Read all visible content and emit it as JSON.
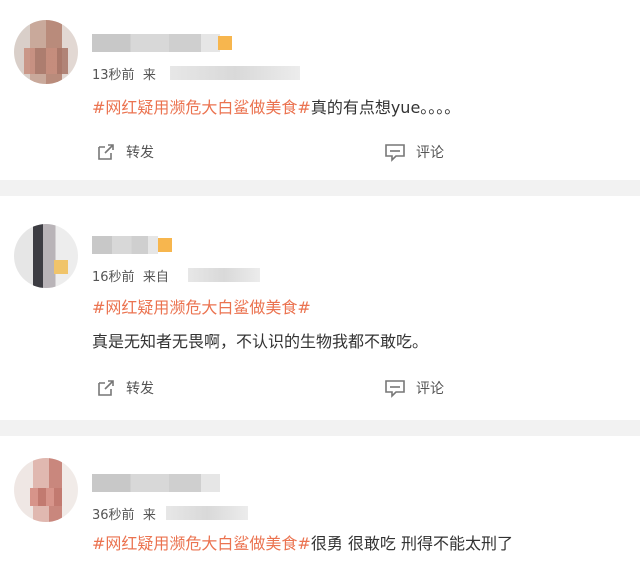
{
  "posts": [
    {
      "time": "13秒前",
      "source": "来",
      "tag": "#网红疑用濒危大白鲨做美食#",
      "text": "真的有点想yue。。。。",
      "repost": "转发",
      "comment": "评论"
    },
    {
      "time": "16秒前",
      "source": "来自",
      "tag": "#网红疑用濒危大白鲨做美食#",
      "text": "真是无知者无畏啊，不认识的生物我都不敢吃。",
      "repost": "转发",
      "comment": "评论"
    },
    {
      "time": "36秒前",
      "source": "来",
      "tag": "#网红疑用濒危大白鲨做美食#",
      "text": "很勇 很敢吃 刑得不能太刑了"
    }
  ],
  "icons": {
    "repost": "share-icon",
    "comment": "comment-icon"
  },
  "colors": {
    "tag": "#eb7350",
    "separator": "#f2f2f2"
  }
}
